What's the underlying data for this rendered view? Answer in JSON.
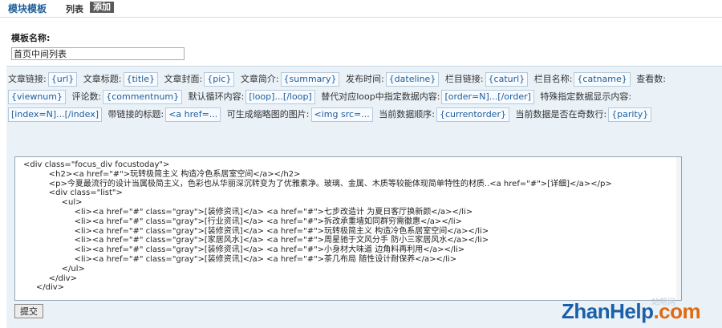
{
  "header": {
    "title": "模块模板",
    "tabs": [
      "列表",
      "添加"
    ]
  },
  "form": {
    "name_label": "模板名称:",
    "name_value": "首页中间列表",
    "submit_label": "提交"
  },
  "variables": [
    {
      "label": "文章链接:",
      "tag": "{url}"
    },
    {
      "label": "文章标题:",
      "tag": "{title}"
    },
    {
      "label": "文章封面:",
      "tag": "{pic}"
    },
    {
      "label": "文章简介:",
      "tag": "{summary}"
    },
    {
      "label": "发布时间:",
      "tag": "{dateline}"
    },
    {
      "label": "栏目链接:",
      "tag": "{caturl}"
    },
    {
      "label": "栏目名称:",
      "tag": "{catname}"
    },
    {
      "label": "查看数:",
      "tag": "{viewnum}"
    },
    {
      "label": "评论数:",
      "tag": "{commentnum}"
    },
    {
      "label": "默认循环内容:",
      "tag": "[loop]...[/loop]"
    },
    {
      "label": "替代对应loop中指定数据内容:",
      "tag": "[order=N]...[/order]"
    },
    {
      "label": "特殊指定数据显示内容:",
      "tag": "[index=N]...[/index]"
    },
    {
      "label": "带链接的标题:",
      "tag": "<a href=..."
    },
    {
      "label": "可生成缩略图的图片:",
      "tag": "<img src=..."
    },
    {
      "label": "当前数据顺序:",
      "tag": "{currentorder}"
    },
    {
      "label": "当前数据是否在奇数行:",
      "tag": "{parity}"
    }
  ],
  "editor": {
    "code": "<div class=\"focus_div focustoday\">\n          <h2><a href=\"#\">玩转极简主义 构造冷色系居室空间</a></h2>\n          <p>今夏最流行的设计当属极简主义，色彩也从华丽深沉转变为了优雅素净。玻璃、金属、木质等较能体现简单特性的材质..<a href=\"#\">[详细]</a></p>\n          <div class=\"list\">\n               <ul>\n                    <li><a href=\"#\" class=\"gray\">[装修资讯]</a> <a href=\"#\">七步改造计 为夏日客厅换新颜</a></li>\n                    <li><a href=\"#\" class=\"gray\">[行业资讯]</a> <a href=\"#\">拆改承重墙如同群穷需徽惠</a></li>\n                    <li><a href=\"#\" class=\"gray\">[装修资讯]</a> <a href=\"#\">玩转极简主义 构造冷色系居室空间</a></li>\n                    <li><a href=\"#\" class=\"gray\">[家居风水]</a> <a href=\"#\">周星驰于文风分手 防小三家居风水</a></li>\n                    <li><a href=\"#\" class=\"gray\">[装修资讯]</a> <a href=\"#\">小身材大味道 边角料再利用</a></li>\n                    <li><a href=\"#\" class=\"gray\">[装修资讯]</a> <a href=\"#\">茶几布局 随性设计耐保养</a></li>\n               </ul>\n          </div>\n     </div>"
  },
  "watermark": {
    "mini": "站帮网",
    "logo_main": "ZhanHelp",
    "logo_tld": ".com"
  }
}
